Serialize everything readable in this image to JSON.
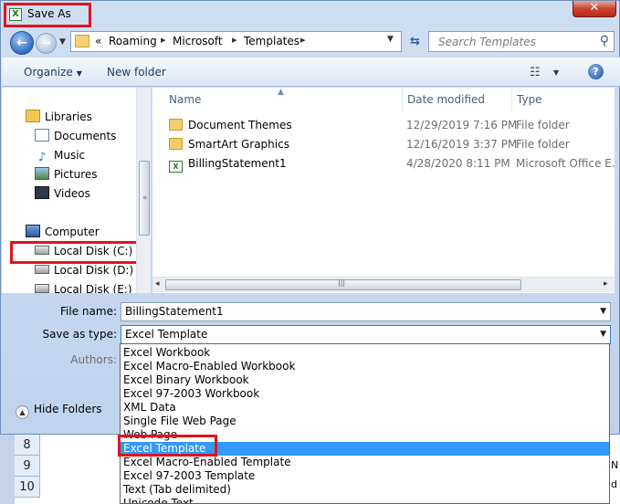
{
  "window": {
    "title": "Save As",
    "close_glyph": "✕",
    "app_icon": "excel-icon"
  },
  "address": {
    "overflow": "«",
    "crumbs": [
      "Roaming",
      "Microsoft",
      "Templates"
    ],
    "search_placeholder": "Search Templates"
  },
  "toolbar": {
    "organize": "Organize",
    "new_folder": "New folder"
  },
  "nav": {
    "items": [
      {
        "label": "Libraries",
        "icon": "libraries-icon"
      },
      {
        "label": "Documents",
        "icon": "documents-icon"
      },
      {
        "label": "Music",
        "icon": "music-icon"
      },
      {
        "label": "Pictures",
        "icon": "pictures-icon"
      },
      {
        "label": "Videos",
        "icon": "videos-icon"
      },
      {
        "label": "Computer",
        "icon": "computer-icon"
      },
      {
        "label": "Local Disk (C:)",
        "icon": "local-disk-icon"
      },
      {
        "label": "Local Disk (D:)",
        "icon": "local-disk-icon"
      },
      {
        "label": "Local Disk (E:)",
        "icon": "local-disk-icon"
      }
    ]
  },
  "files": {
    "columns": {
      "name": "Name",
      "date": "Date modified",
      "type": "Type"
    },
    "rows": [
      {
        "name": "Document Themes",
        "date": "12/29/2019 7:16 PM",
        "type": "File folder",
        "icon": "folder-icon"
      },
      {
        "name": "SmartArt Graphics",
        "date": "12/16/2019 3:37 PM",
        "type": "File folder",
        "icon": "folder-icon"
      },
      {
        "name": "BillingStatement1",
        "date": "4/28/2020 8:11 PM",
        "type": "Microsoft Office E...",
        "icon": "excel-file-icon"
      }
    ]
  },
  "form": {
    "file_name_label": "File name:",
    "file_name_value": "BillingStatement1",
    "save_type_label": "Save as type:",
    "save_type_value": "Excel Template",
    "authors_label": "Authors:",
    "hide_folders": "Hide Folders"
  },
  "save_type_options": [
    "Excel Workbook",
    "Excel Macro-Enabled Workbook",
    "Excel Binary Workbook",
    "Excel 97-2003 Workbook",
    "XML Data",
    "Single File Web Page",
    "Web Page",
    "Excel Template",
    "Excel Macro-Enabled Template",
    "Excel 97-2003 Template",
    "Text (Tab delimited)",
    "Unicode Text"
  ],
  "selected_option_index": 7,
  "sheet": {
    "rows": [
      "8",
      "9",
      "10"
    ],
    "right_cells": [
      "N",
      "d"
    ]
  },
  "colors": {
    "highlight": "#e0141e",
    "selection": "#3399ff"
  }
}
